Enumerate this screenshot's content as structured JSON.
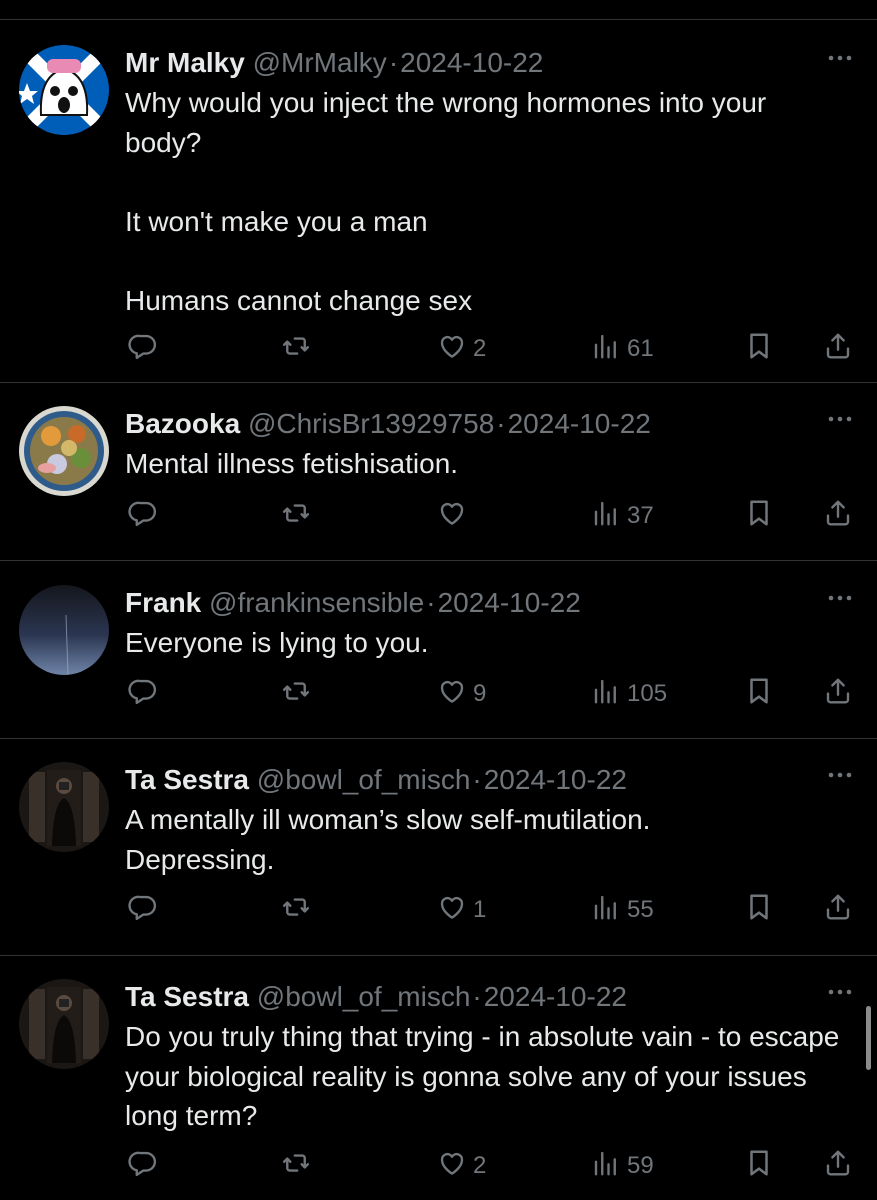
{
  "tweets": [
    {
      "name": "Mr Malky",
      "handle": "@MrMalky",
      "sep": "·",
      "date": "2024-10-22",
      "text": "Why would you inject the wrong hormones into your body?\n\nIt won't make you a man\n\nHumans cannot change sex",
      "likes": "2",
      "views": "61",
      "avatar": "scottish-flag-ghost"
    },
    {
      "name": "Bazooka",
      "handle": "@ChrisBr13929758",
      "sep": "·",
      "date": "2024-10-22",
      "text": "Mental illness fetishisation.",
      "likes": "",
      "views": "37",
      "avatar": "food-plate"
    },
    {
      "name": "Frank",
      "handle": "@frankinsensible",
      "sep": "·",
      "date": "2024-10-22",
      "text": "Everyone is lying to you.",
      "likes": "9",
      "views": "105",
      "avatar": "night-sky"
    },
    {
      "name": "Ta Sestra",
      "handle": "@bowl_of_misch",
      "sep": "·",
      "date": "2024-10-22",
      "text": "A mentally ill woman’s slow self-mutilation.\nDepressing.",
      "likes": "1",
      "views": "55",
      "avatar": "mirror-selfie"
    },
    {
      "name": "Ta Sestra",
      "handle": "@bowl_of_misch",
      "sep": "·",
      "date": "2024-10-22",
      "text": "Do you truly thing that trying - in absolute vain - to escape your biological reality is gonna solve any of your issues long term?",
      "likes": "2",
      "views": "59",
      "avatar": "mirror-selfie"
    }
  ],
  "icons": {
    "reply": "reply-icon",
    "retweet": "retweet-icon",
    "like": "heart-icon",
    "views": "views-icon",
    "bookmark": "bookmark-icon",
    "share": "share-icon",
    "more": "more-icon"
  },
  "colors": {
    "background": "#000000",
    "text": "#e7e9ea",
    "muted": "#71767b",
    "divider": "#2f3336"
  }
}
